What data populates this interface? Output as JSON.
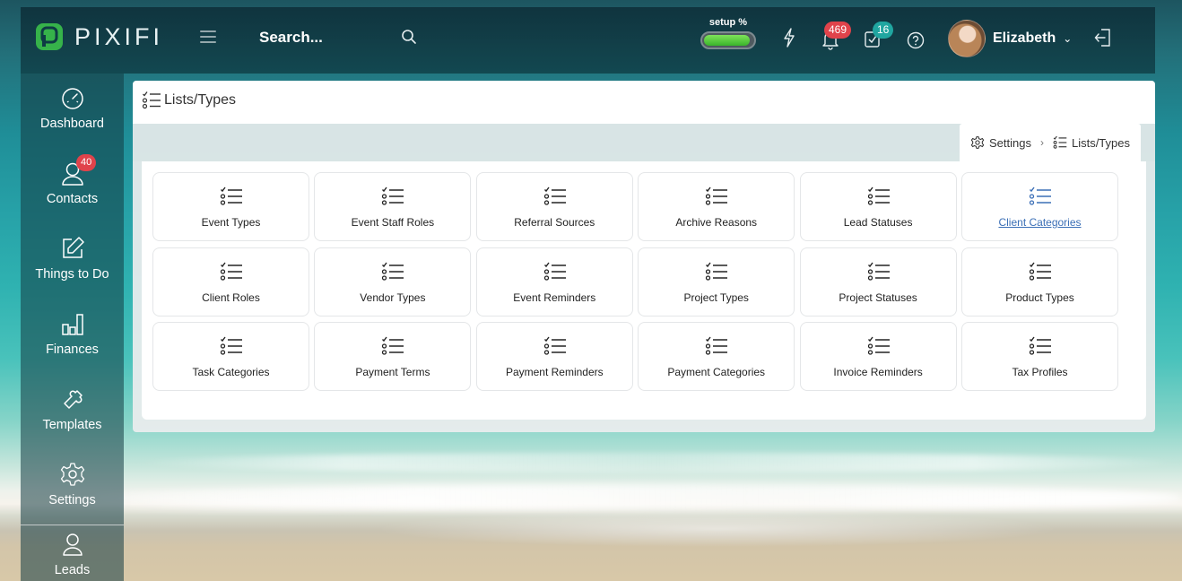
{
  "app": {
    "logo_text": "PIXIFI",
    "search_label": "Search...",
    "setup_label": "setup %",
    "setup_progress": 0.95,
    "notifications_count": "469",
    "tasks_count": "16",
    "user_name": "Elizabeth",
    "colors": {
      "logo_green": "#36b24a",
      "badge_red": "#e0434b",
      "badge_teal": "#20a6a0",
      "link_blue": "#3b6fb6"
    }
  },
  "sidebar": {
    "items": [
      {
        "label": "Dashboard",
        "icon": "gauge-icon"
      },
      {
        "label": "Contacts",
        "icon": "person-icon",
        "badge": "40"
      },
      {
        "label": "Things to Do",
        "icon": "edit-icon"
      },
      {
        "label": "Finances",
        "icon": "bar-chart-icon"
      },
      {
        "label": "Templates",
        "icon": "puzzle-icon"
      },
      {
        "label": "Settings",
        "icon": "gear-icon"
      },
      {
        "label": "Leads",
        "icon": "person-outline-icon"
      }
    ]
  },
  "page": {
    "title": "Lists/Types",
    "breadcrumb": [
      "Settings",
      "Lists/Types"
    ]
  },
  "tiles": [
    {
      "label": "Event Types"
    },
    {
      "label": "Event Staff Roles"
    },
    {
      "label": "Referral Sources"
    },
    {
      "label": "Archive Reasons"
    },
    {
      "label": "Lead Statuses"
    },
    {
      "label": "Client Categories",
      "active": true
    },
    {
      "label": "Client Roles"
    },
    {
      "label": "Vendor Types"
    },
    {
      "label": "Event Reminders"
    },
    {
      "label": "Project Types"
    },
    {
      "label": "Project Statuses"
    },
    {
      "label": "Product Types"
    },
    {
      "label": "Task Categories"
    },
    {
      "label": "Payment Terms"
    },
    {
      "label": "Payment Reminders"
    },
    {
      "label": "Payment Categories"
    },
    {
      "label": "Invoice Reminders"
    },
    {
      "label": "Tax Profiles"
    }
  ]
}
